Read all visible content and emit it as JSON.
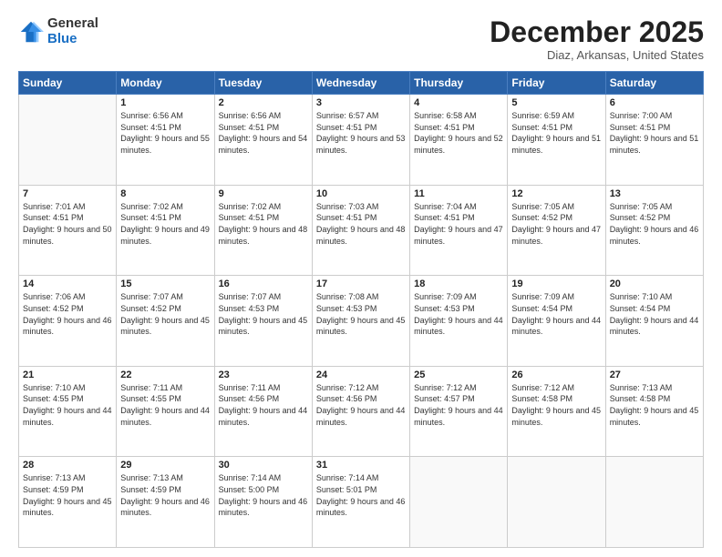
{
  "logo": {
    "general": "General",
    "blue": "Blue"
  },
  "title": {
    "month": "December 2025",
    "location": "Diaz, Arkansas, United States"
  },
  "headers": [
    "Sunday",
    "Monday",
    "Tuesday",
    "Wednesday",
    "Thursday",
    "Friday",
    "Saturday"
  ],
  "weeks": [
    [
      {
        "day": "",
        "sunrise": "",
        "sunset": "",
        "daylight": ""
      },
      {
        "day": "1",
        "sunrise": "Sunrise: 6:56 AM",
        "sunset": "Sunset: 4:51 PM",
        "daylight": "Daylight: 9 hours and 55 minutes."
      },
      {
        "day": "2",
        "sunrise": "Sunrise: 6:56 AM",
        "sunset": "Sunset: 4:51 PM",
        "daylight": "Daylight: 9 hours and 54 minutes."
      },
      {
        "day": "3",
        "sunrise": "Sunrise: 6:57 AM",
        "sunset": "Sunset: 4:51 PM",
        "daylight": "Daylight: 9 hours and 53 minutes."
      },
      {
        "day": "4",
        "sunrise": "Sunrise: 6:58 AM",
        "sunset": "Sunset: 4:51 PM",
        "daylight": "Daylight: 9 hours and 52 minutes."
      },
      {
        "day": "5",
        "sunrise": "Sunrise: 6:59 AM",
        "sunset": "Sunset: 4:51 PM",
        "daylight": "Daylight: 9 hours and 51 minutes."
      },
      {
        "day": "6",
        "sunrise": "Sunrise: 7:00 AM",
        "sunset": "Sunset: 4:51 PM",
        "daylight": "Daylight: 9 hours and 51 minutes."
      }
    ],
    [
      {
        "day": "7",
        "sunrise": "Sunrise: 7:01 AM",
        "sunset": "Sunset: 4:51 PM",
        "daylight": "Daylight: 9 hours and 50 minutes."
      },
      {
        "day": "8",
        "sunrise": "Sunrise: 7:02 AM",
        "sunset": "Sunset: 4:51 PM",
        "daylight": "Daylight: 9 hours and 49 minutes."
      },
      {
        "day": "9",
        "sunrise": "Sunrise: 7:02 AM",
        "sunset": "Sunset: 4:51 PM",
        "daylight": "Daylight: 9 hours and 48 minutes."
      },
      {
        "day": "10",
        "sunrise": "Sunrise: 7:03 AM",
        "sunset": "Sunset: 4:51 PM",
        "daylight": "Daylight: 9 hours and 48 minutes."
      },
      {
        "day": "11",
        "sunrise": "Sunrise: 7:04 AM",
        "sunset": "Sunset: 4:51 PM",
        "daylight": "Daylight: 9 hours and 47 minutes."
      },
      {
        "day": "12",
        "sunrise": "Sunrise: 7:05 AM",
        "sunset": "Sunset: 4:52 PM",
        "daylight": "Daylight: 9 hours and 47 minutes."
      },
      {
        "day": "13",
        "sunrise": "Sunrise: 7:05 AM",
        "sunset": "Sunset: 4:52 PM",
        "daylight": "Daylight: 9 hours and 46 minutes."
      }
    ],
    [
      {
        "day": "14",
        "sunrise": "Sunrise: 7:06 AM",
        "sunset": "Sunset: 4:52 PM",
        "daylight": "Daylight: 9 hours and 46 minutes."
      },
      {
        "day": "15",
        "sunrise": "Sunrise: 7:07 AM",
        "sunset": "Sunset: 4:52 PM",
        "daylight": "Daylight: 9 hours and 45 minutes."
      },
      {
        "day": "16",
        "sunrise": "Sunrise: 7:07 AM",
        "sunset": "Sunset: 4:53 PM",
        "daylight": "Daylight: 9 hours and 45 minutes."
      },
      {
        "day": "17",
        "sunrise": "Sunrise: 7:08 AM",
        "sunset": "Sunset: 4:53 PM",
        "daylight": "Daylight: 9 hours and 45 minutes."
      },
      {
        "day": "18",
        "sunrise": "Sunrise: 7:09 AM",
        "sunset": "Sunset: 4:53 PM",
        "daylight": "Daylight: 9 hours and 44 minutes."
      },
      {
        "day": "19",
        "sunrise": "Sunrise: 7:09 AM",
        "sunset": "Sunset: 4:54 PM",
        "daylight": "Daylight: 9 hours and 44 minutes."
      },
      {
        "day": "20",
        "sunrise": "Sunrise: 7:10 AM",
        "sunset": "Sunset: 4:54 PM",
        "daylight": "Daylight: 9 hours and 44 minutes."
      }
    ],
    [
      {
        "day": "21",
        "sunrise": "Sunrise: 7:10 AM",
        "sunset": "Sunset: 4:55 PM",
        "daylight": "Daylight: 9 hours and 44 minutes."
      },
      {
        "day": "22",
        "sunrise": "Sunrise: 7:11 AM",
        "sunset": "Sunset: 4:55 PM",
        "daylight": "Daylight: 9 hours and 44 minutes."
      },
      {
        "day": "23",
        "sunrise": "Sunrise: 7:11 AM",
        "sunset": "Sunset: 4:56 PM",
        "daylight": "Daylight: 9 hours and 44 minutes."
      },
      {
        "day": "24",
        "sunrise": "Sunrise: 7:12 AM",
        "sunset": "Sunset: 4:56 PM",
        "daylight": "Daylight: 9 hours and 44 minutes."
      },
      {
        "day": "25",
        "sunrise": "Sunrise: 7:12 AM",
        "sunset": "Sunset: 4:57 PM",
        "daylight": "Daylight: 9 hours and 44 minutes."
      },
      {
        "day": "26",
        "sunrise": "Sunrise: 7:12 AM",
        "sunset": "Sunset: 4:58 PM",
        "daylight": "Daylight: 9 hours and 45 minutes."
      },
      {
        "day": "27",
        "sunrise": "Sunrise: 7:13 AM",
        "sunset": "Sunset: 4:58 PM",
        "daylight": "Daylight: 9 hours and 45 minutes."
      }
    ],
    [
      {
        "day": "28",
        "sunrise": "Sunrise: 7:13 AM",
        "sunset": "Sunset: 4:59 PM",
        "daylight": "Daylight: 9 hours and 45 minutes."
      },
      {
        "day": "29",
        "sunrise": "Sunrise: 7:13 AM",
        "sunset": "Sunset: 4:59 PM",
        "daylight": "Daylight: 9 hours and 46 minutes."
      },
      {
        "day": "30",
        "sunrise": "Sunrise: 7:14 AM",
        "sunset": "Sunset: 5:00 PM",
        "daylight": "Daylight: 9 hours and 46 minutes."
      },
      {
        "day": "31",
        "sunrise": "Sunrise: 7:14 AM",
        "sunset": "Sunset: 5:01 PM",
        "daylight": "Daylight: 9 hours and 46 minutes."
      },
      {
        "day": "",
        "sunrise": "",
        "sunset": "",
        "daylight": ""
      },
      {
        "day": "",
        "sunrise": "",
        "sunset": "",
        "daylight": ""
      },
      {
        "day": "",
        "sunrise": "",
        "sunset": "",
        "daylight": ""
      }
    ]
  ]
}
